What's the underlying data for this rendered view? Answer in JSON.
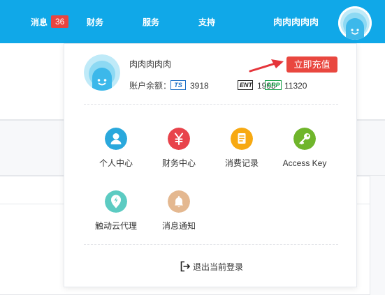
{
  "nav": {
    "messages_label": "消息",
    "messages_count": "36",
    "finance_label": "财务",
    "service_label": "服务",
    "support_label": "支持",
    "username": "肉肉肉肉肉"
  },
  "profile": {
    "name": "肉肉肉肉肉",
    "balance_label": "账户余额：",
    "balances": [
      {
        "icon": "ts-currency-icon",
        "icon_text": "TS",
        "value": "3918"
      },
      {
        "icon": "ent-currency-icon",
        "icon_text": "ENT",
        "value": "1995"
      },
      {
        "icon": "app-currency-icon",
        "icon_text": "APP",
        "value": "11320"
      }
    ],
    "recharge_label": "立即充值"
  },
  "menu": [
    {
      "label": "个人中心",
      "icon": "user-icon",
      "color": "#2aa8dc"
    },
    {
      "label": "财务中心",
      "icon": "yen-icon",
      "color": "#e8434b"
    },
    {
      "label": "消费记录",
      "icon": "receipt-icon",
      "color": "#f7a912"
    },
    {
      "label": "Access Key",
      "icon": "key-icon",
      "color": "#6fb52b"
    },
    {
      "label": "触动云代理",
      "icon": "lightning-location-icon",
      "color": "#5ccbc2"
    },
    {
      "label": "消息通知",
      "icon": "bell-icon",
      "color": "#e4b890"
    }
  ],
  "logout_label": "退出当前登录",
  "colors": {
    "nav_bg": "#10a8e8",
    "badge": "#e9443f",
    "recharge": "#e9473f",
    "arrow": "#e5343a"
  }
}
